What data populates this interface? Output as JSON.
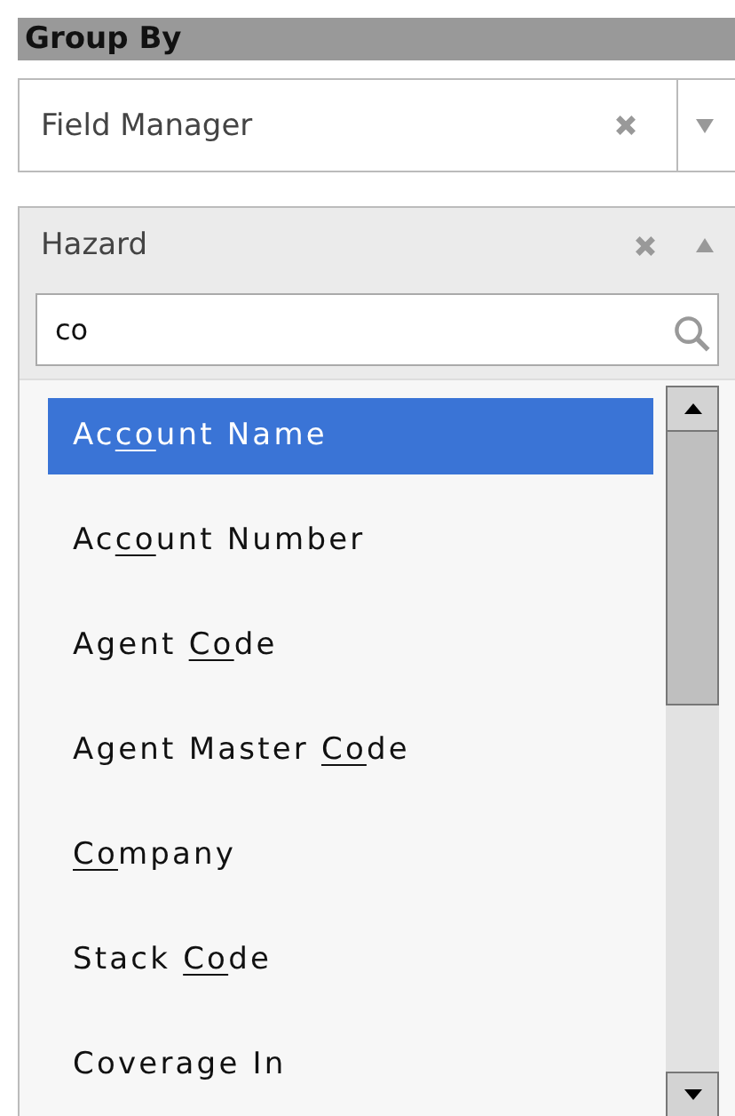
{
  "section_title": "Group By",
  "group_fields": [
    {
      "value": "Field Manager",
      "expanded": false
    },
    {
      "value": "Hazard",
      "expanded": true
    }
  ],
  "search": {
    "value": "co"
  },
  "options": [
    {
      "segments": [
        {
          "text": "Ac",
          "underlined": false
        },
        {
          "text": "co",
          "underlined": true
        },
        {
          "text": "unt Name",
          "underlined": false
        }
      ],
      "selected": true
    },
    {
      "segments": [
        {
          "text": "Ac",
          "underlined": false
        },
        {
          "text": "co",
          "underlined": true
        },
        {
          "text": "unt Number",
          "underlined": false
        }
      ],
      "selected": false
    },
    {
      "segments": [
        {
          "text": "Agent ",
          "underlined": false
        },
        {
          "text": "Co",
          "underlined": true
        },
        {
          "text": "de",
          "underlined": false
        }
      ],
      "selected": false
    },
    {
      "segments": [
        {
          "text": "Agent Master ",
          "underlined": false
        },
        {
          "text": "Co",
          "underlined": true
        },
        {
          "text": "de",
          "underlined": false
        }
      ],
      "selected": false
    },
    {
      "segments": [
        {
          "text": "Co",
          "underlined": true
        },
        {
          "text": "mpany",
          "underlined": false
        }
      ],
      "selected": false
    },
    {
      "segments": [
        {
          "text": "Stack ",
          "underlined": false
        },
        {
          "text": "Co",
          "underlined": true
        },
        {
          "text": "de",
          "underlined": false
        }
      ],
      "selected": false
    },
    {
      "segments": [
        {
          "text": "Coverage In",
          "underlined": false
        }
      ],
      "selected": false
    }
  ]
}
